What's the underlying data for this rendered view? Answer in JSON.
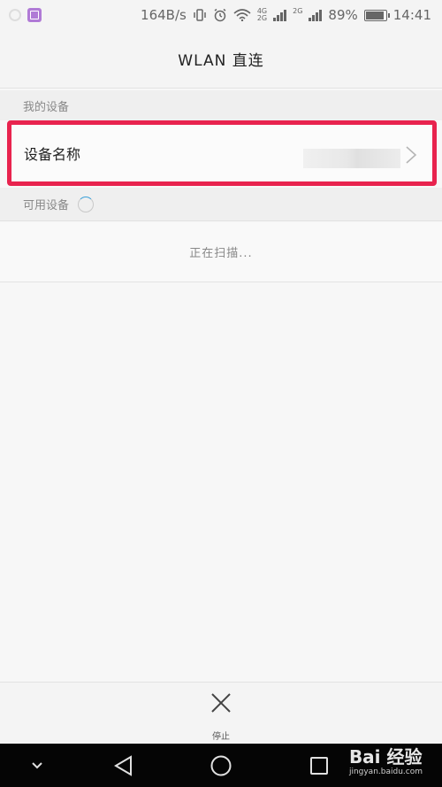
{
  "status_bar": {
    "speed": "164B/s",
    "net_top": "4G",
    "net_bottom": "2G",
    "net2": "2G",
    "battery": "89%",
    "battery_level": 0.89,
    "time": "14:41"
  },
  "title": "WLAN 直连",
  "sections": {
    "my_devices": "我的设备",
    "available_devices": "可用设备"
  },
  "device": {
    "label": "设备名称",
    "value": ""
  },
  "scanning": "正在扫描...",
  "stop_label": "停止",
  "watermark": {
    "main": "Bai 经验",
    "sub": "jingyan.baidu.com"
  },
  "colors": {
    "highlight_border": "#e8234e",
    "spinner_accent": "#3aa0d8",
    "nav_bg": "#050505"
  }
}
